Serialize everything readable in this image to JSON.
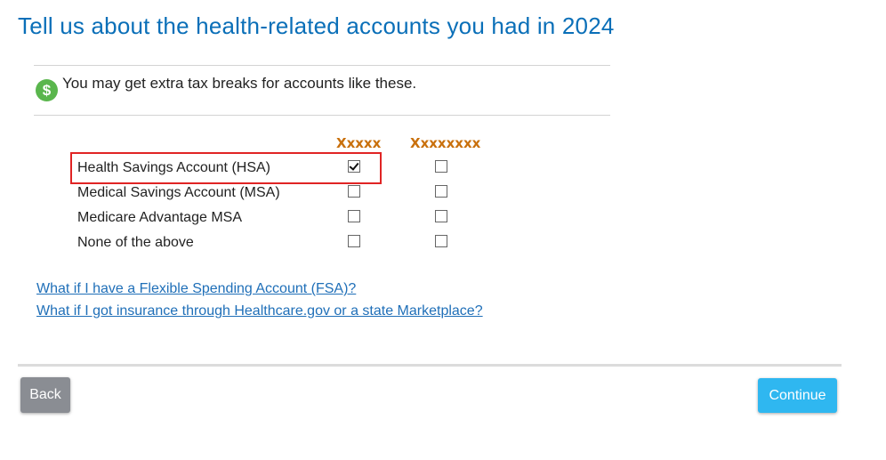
{
  "page": {
    "title": "Tell us about the health-related accounts you had in 2024"
  },
  "tip": {
    "icon": "dollar-icon",
    "icon_glyph": "$",
    "icon_color": "#5ab64d",
    "text": "You may get extra tax breaks for accounts like these."
  },
  "table": {
    "columns": [
      "Xxxxx",
      "Xxxxxxxx"
    ],
    "rows": [
      {
        "label": "Health Savings Account (HSA)",
        "checked": [
          true,
          false
        ]
      },
      {
        "label": "Medical Savings Account (MSA)",
        "checked": [
          false,
          false
        ]
      },
      {
        "label": "Medicare Advantage MSA",
        "checked": [
          false,
          false
        ]
      },
      {
        "label": "None of the above",
        "checked": [
          false,
          false
        ]
      }
    ]
  },
  "links": [
    "What if I have a Flexible Spending Account (FSA)?",
    "What if I got insurance through Healthcare.gov or a state Marketplace?"
  ],
  "buttons": {
    "back_label": "Back",
    "continue_label": "Continue"
  },
  "colors": {
    "title": "#0a6fb8",
    "column_header": "#c9700c",
    "link": "#1f6fb8",
    "continue": "#2fb7f0",
    "back": "#8a8d93",
    "highlight": "#e02424"
  }
}
